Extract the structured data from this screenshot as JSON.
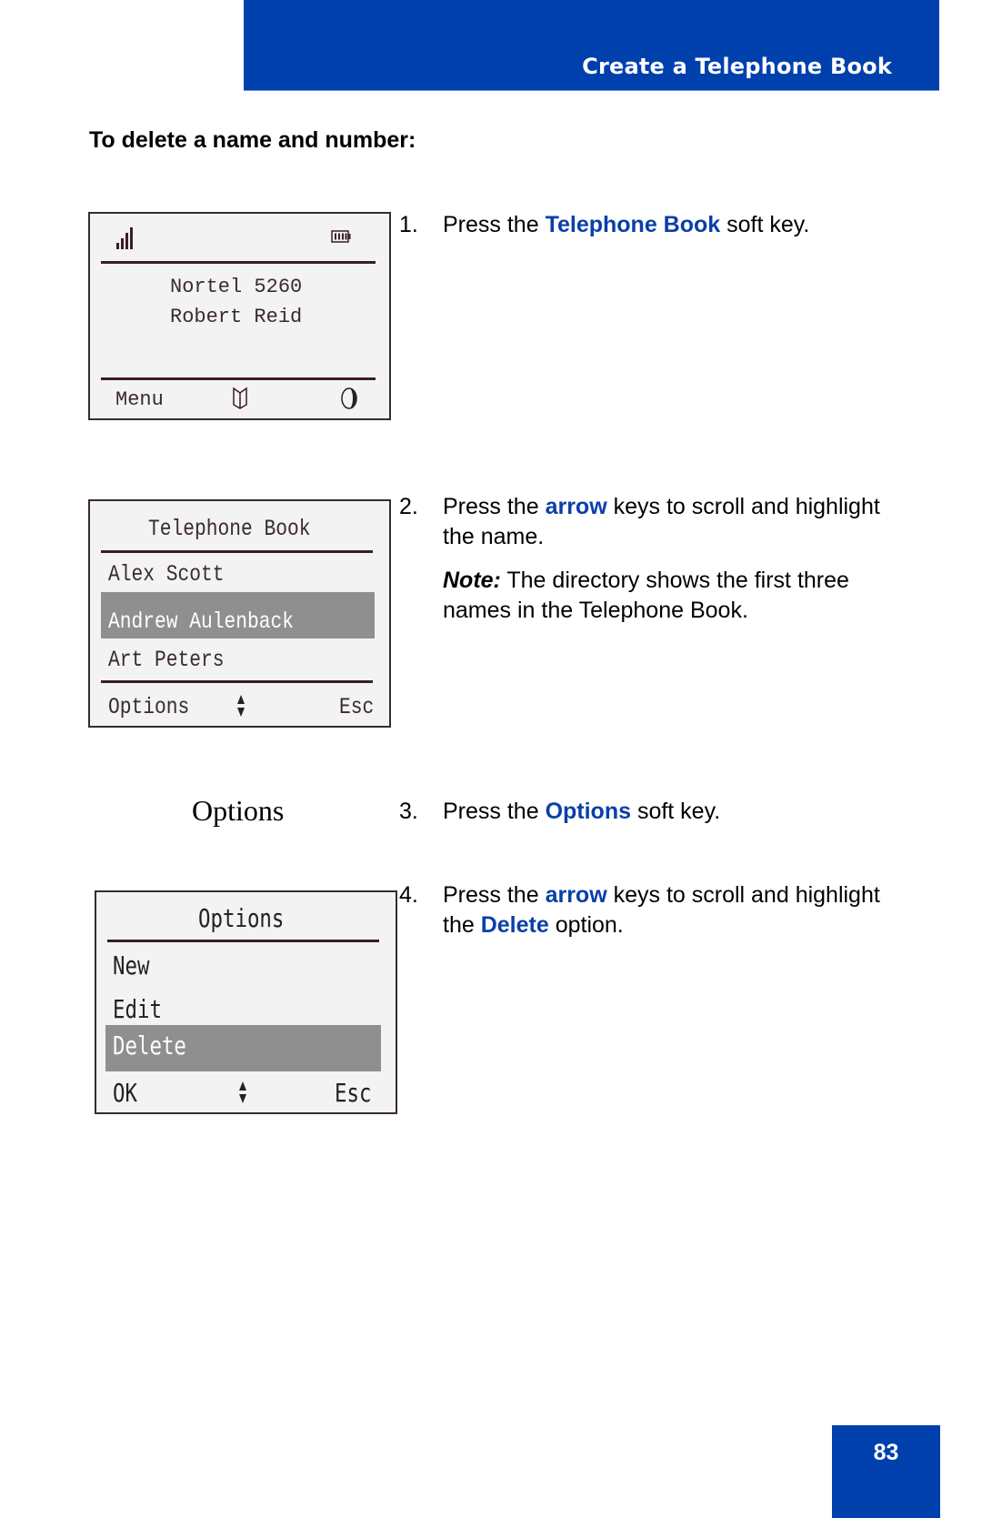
{
  "header": {
    "title": "Create a Telephone Book",
    "color": "#0040ad"
  },
  "section_heading": "To delete a name and number:",
  "screens": {
    "idle": {
      "status_icons": [
        "signal-strength-icon",
        "battery-icon"
      ],
      "lines": [
        "Nortel 5260",
        "Robert Reid"
      ],
      "softkeys": {
        "left": "Menu",
        "center_icon": "telephone-book-icon",
        "right_icon": "contrast-icon"
      }
    },
    "telephone_book": {
      "title": "Telephone Book",
      "items": [
        "Alex Scott",
        "Andrew Aulenback",
        "Art Peters"
      ],
      "highlighted_index": 1,
      "softkeys": {
        "left": "Options",
        "center_icon": "scroll-arrows-icon",
        "right": "Esc"
      }
    },
    "options_caption": "Options",
    "options": {
      "title": "Options",
      "items": [
        "New",
        "Edit",
        "Delete"
      ],
      "highlighted_index": 2,
      "softkeys": {
        "left": "OK",
        "center_icon": "scroll-arrows-icon",
        "right": "Esc"
      }
    }
  },
  "steps": [
    {
      "num": "1.",
      "pre": "Press the ",
      "key": "Telephone Book",
      "post": " soft key."
    },
    {
      "num": "2.",
      "pre": "Press the ",
      "key": "arrow",
      "post": " keys to scroll and highlight the name.",
      "note_label": "Note:",
      "note_text": " The directory shows the first three names in the Telephone Book."
    },
    {
      "num": "3.",
      "pre": "Press the ",
      "key": "Options",
      "post": " soft key."
    },
    {
      "num": "4.",
      "pre": "Press the ",
      "key": "arrow",
      "post": " keys to scroll and highlight the ",
      "key2": "Delete",
      "post2": " option."
    }
  ],
  "page_number": "83"
}
